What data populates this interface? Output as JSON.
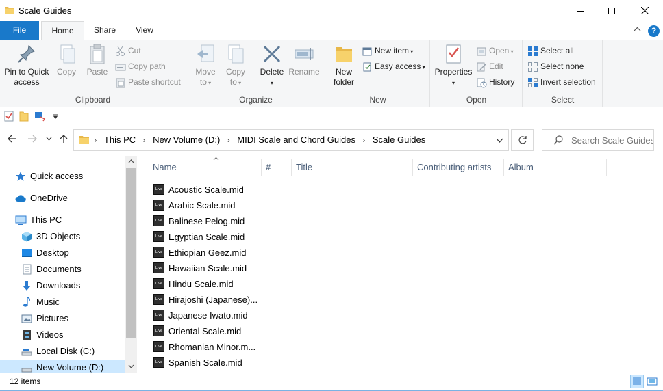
{
  "window": {
    "title": "Scale Guides",
    "icon": "folder-icon"
  },
  "tabs": [
    {
      "label": "File"
    },
    {
      "label": "Home"
    },
    {
      "label": "Share"
    },
    {
      "label": "View"
    }
  ],
  "ribbon": {
    "clipboard": {
      "label": "Clipboard",
      "pin_line1": "Pin to Quick",
      "pin_line2": "access",
      "copy": "Copy",
      "paste": "Paste",
      "cut": "Cut",
      "copy_path": "Copy path",
      "paste_shortcut": "Paste shortcut"
    },
    "organize": {
      "label": "Organize",
      "move_line1": "Move",
      "move_line2": "to",
      "copy_line1": "Copy",
      "copy_line2": "to",
      "delete": "Delete",
      "rename": "Rename"
    },
    "new": {
      "label": "New",
      "folder_line1": "New",
      "folder_line2": "folder",
      "new_item": "New item",
      "easy_access": "Easy access"
    },
    "open": {
      "label": "Open",
      "properties": "Properties",
      "open": "Open",
      "edit": "Edit",
      "history": "History"
    },
    "select": {
      "label": "Select",
      "select_all": "Select all",
      "select_none": "Select none",
      "invert": "Invert selection"
    }
  },
  "address": {
    "crumbs": [
      "This PC",
      "New Volume (D:)",
      "MIDI Scale and Chord Guides",
      "Scale Guides"
    ],
    "search_placeholder": "Search Scale Guides"
  },
  "nav": {
    "quick_access": "Quick access",
    "onedrive": "OneDrive",
    "this_pc": "This PC",
    "objects3d": "3D Objects",
    "desktop": "Desktop",
    "documents": "Documents",
    "downloads": "Downloads",
    "music": "Music",
    "pictures": "Pictures",
    "videos": "Videos",
    "local_disk": "Local Disk (C:)",
    "new_volume": "New Volume (D:)"
  },
  "columns": {
    "name": "Name",
    "number": "#",
    "title": "Title",
    "artists": "Contributing artists",
    "album": "Album"
  },
  "files": [
    {
      "name": "Acoustic Scale.mid"
    },
    {
      "name": "Arabic Scale.mid"
    },
    {
      "name": "Balinese Pelog.mid"
    },
    {
      "name": "Egyptian Scale.mid"
    },
    {
      "name": "Ethiopian Geez.mid"
    },
    {
      "name": "Hawaiian Scale.mid"
    },
    {
      "name": "Hindu Scale.mid"
    },
    {
      "name": "Hirajoshi (Japanese)..."
    },
    {
      "name": "Japanese Iwato.mid"
    },
    {
      "name": "Oriental Scale.mid"
    },
    {
      "name": "Rhomanian Minor.m..."
    },
    {
      "name": "Spanish Scale.mid"
    }
  ],
  "file_icon_text": "Live",
  "status": {
    "count": "12 items"
  },
  "colors": {
    "accent": "#1979ca",
    "ribbon_bg": "#f5f6f7",
    "selected_bg": "#cce8ff",
    "header_text": "#4c607a"
  }
}
